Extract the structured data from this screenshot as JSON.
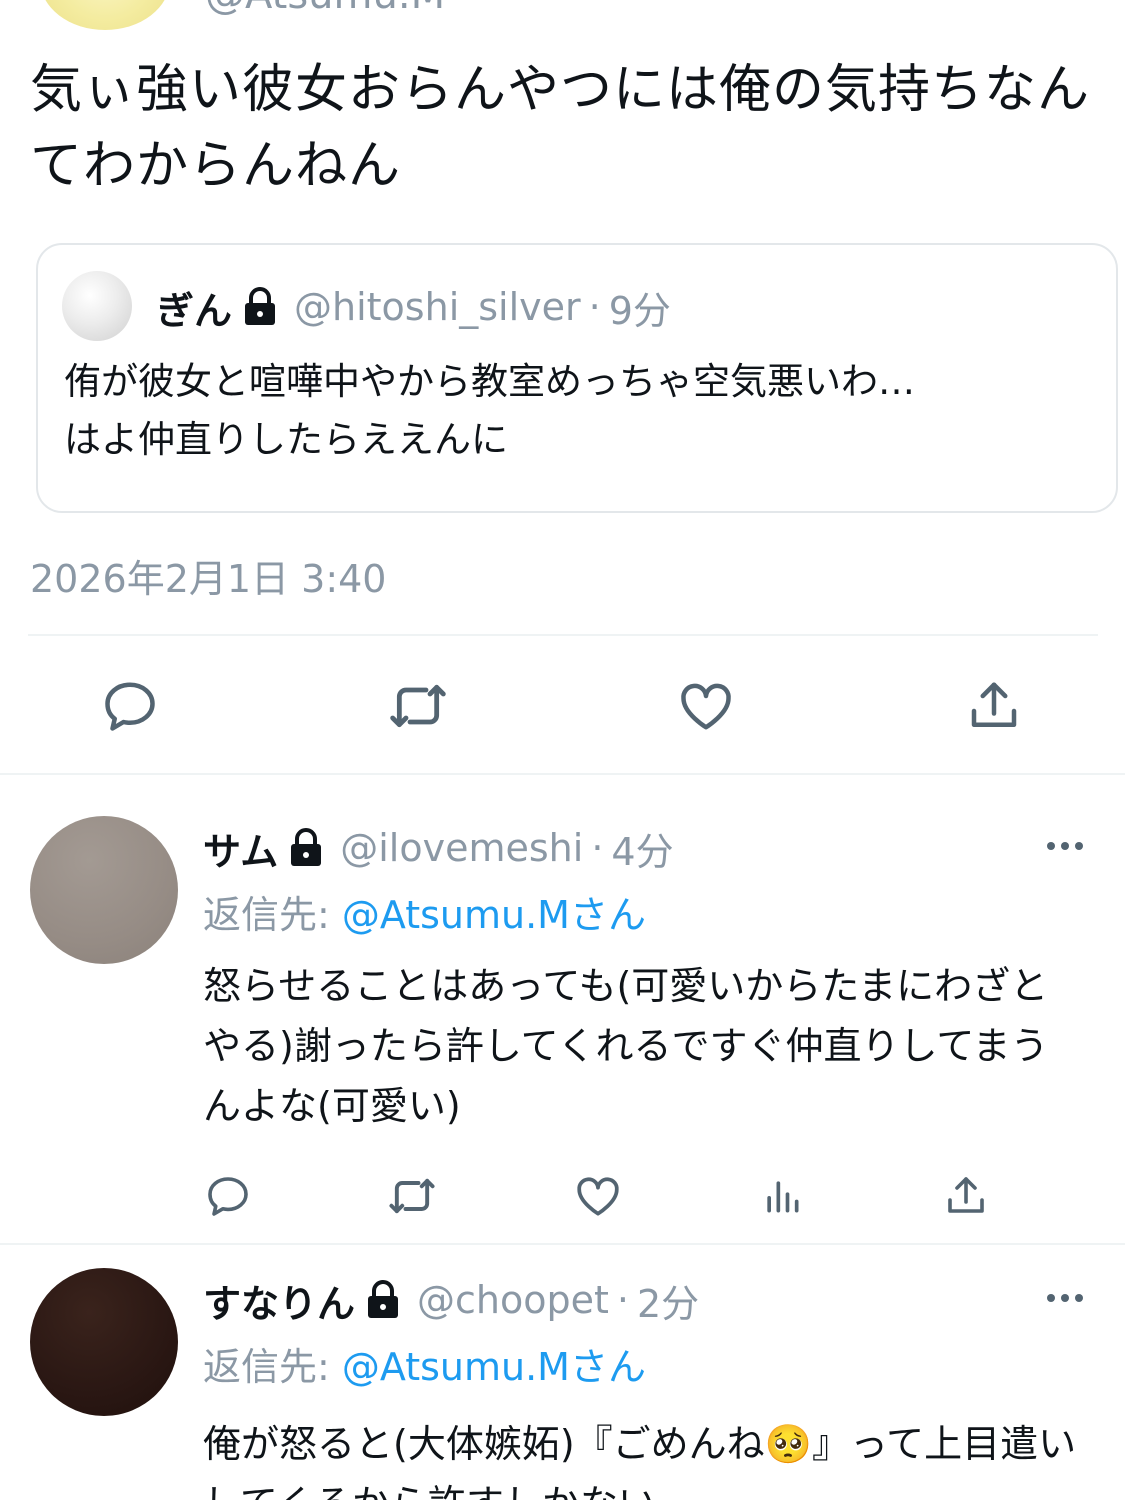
{
  "tweet": {
    "handle": "@Atsumu.M",
    "text": "気ぃ強い彼女おらんやつには俺の気持ちなんてわからんねん",
    "timestamp": "2026年2月1日 3:40",
    "actions": [
      "reply-icon",
      "retweet-icon",
      "like-icon",
      "share-icon"
    ]
  },
  "quote": {
    "name": "ぎん",
    "handle": "@hitoshi_silver",
    "separator": "·",
    "time": "9分",
    "text": "侑が彼女と喧嘩中やから教室めっちゃ空気悪いわ…\nはよ仲直りしたらええんに"
  },
  "replies": [
    {
      "name": "サム",
      "handle": "@ilovemeshi",
      "separator": "·",
      "time": "4分",
      "reply_to_label": "返信先: ",
      "reply_to_mention": "@Atsumu.Mさん",
      "text": "怒らせることはあっても(可愛いからたまにわざとやる)謝ったら許してくれるですぐ仲直りしてまうんよな(可愛い)",
      "avatar_color": "#9a9089"
    },
    {
      "name": "すなりん",
      "handle": "@choopet",
      "separator": "·",
      "time": "2分",
      "reply_to_label": "返信先: ",
      "reply_to_mention": "@Atsumu.Mさん",
      "text": "俺が怒ると(大体嫉妬)『ごめんね🥺』って上目遣いしてくるから許すしかない",
      "avatar_color": "#2a1713"
    }
  ],
  "colors": {
    "muted": "#8b98a5",
    "link": "#1d9bf0",
    "text": "#0f1419",
    "border": "#e3e7ea"
  }
}
